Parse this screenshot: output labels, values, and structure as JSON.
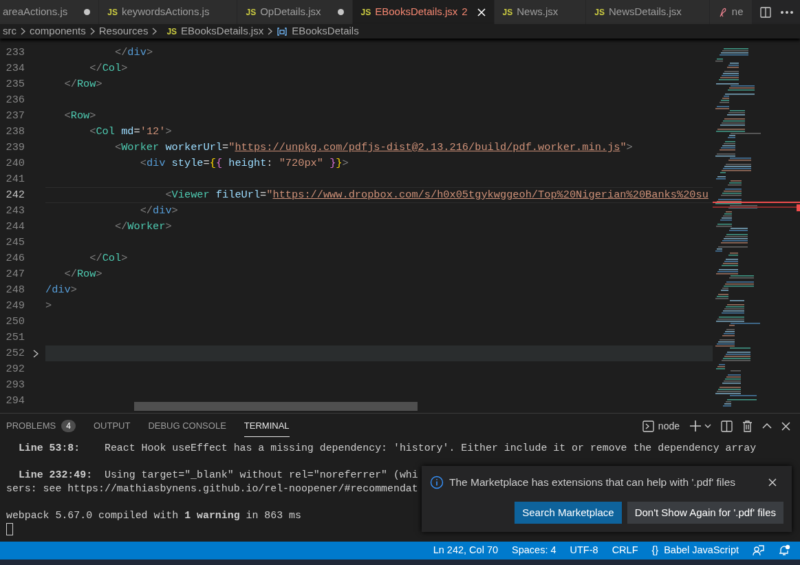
{
  "tabs": [
    {
      "label": "areaActions.js",
      "kind": "plain",
      "selected": false,
      "modified": true
    },
    {
      "label": "keywordsActions.js",
      "kind": "js",
      "icon_text": "JS",
      "selected": false,
      "modified": false
    },
    {
      "label": "OpDetails.jsx",
      "kind": "js",
      "icon_text": "JS",
      "selected": false,
      "modified": true
    },
    {
      "label": "EBooksDetails.jsx",
      "kind": "js",
      "icon_text": "JS",
      "selected": true,
      "modified": false,
      "problems": "2"
    },
    {
      "label": "News.jsx",
      "kind": "js",
      "icon_text": "JS",
      "selected": false,
      "modified": false
    },
    {
      "label": "NewsDetails.jsx",
      "kind": "js",
      "icon_text": "JS",
      "selected": false,
      "modified": false
    },
    {
      "label": "ne",
      "kind": "misc",
      "selected": false,
      "modified": false
    }
  ],
  "breadcrumb": [
    {
      "text": "src",
      "kind": "folder"
    },
    {
      "text": "components",
      "kind": "folder"
    },
    {
      "text": "Resources",
      "kind": "folder"
    },
    {
      "text": "EBooksDetails.jsx",
      "kind": "file",
      "icon_text": "JS"
    },
    {
      "text": "EBooksDetails",
      "kind": "symbol"
    }
  ],
  "lines": [
    {
      "number": "233",
      "current": false,
      "highlighted": false,
      "tokens": [
        {
          "kind": "p",
          "t": "           </"
        },
        {
          "kind": "html",
          "t": "div"
        },
        {
          "kind": "p",
          "t": ">"
        }
      ]
    },
    {
      "number": "234",
      "current": false,
      "highlighted": false,
      "tokens": [
        {
          "kind": "p",
          "t": "       </"
        },
        {
          "kind": "comp",
          "t": "Col"
        },
        {
          "kind": "p",
          "t": ">"
        }
      ]
    },
    {
      "number": "235",
      "current": false,
      "highlighted": false,
      "tokens": [
        {
          "kind": "p",
          "t": "   </"
        },
        {
          "kind": "comp",
          "t": "Row"
        },
        {
          "kind": "p",
          "t": ">"
        }
      ]
    },
    {
      "number": "236",
      "current": false,
      "highlighted": false
    },
    {
      "number": "237",
      "current": false,
      "highlighted": false,
      "tokens": [
        {
          "kind": "p",
          "t": "   <"
        },
        {
          "kind": "comp",
          "t": "Row"
        },
        {
          "kind": "p",
          "t": ">"
        }
      ]
    },
    {
      "number": "238",
      "current": false,
      "highlighted": false,
      "tokens": [
        {
          "kind": "p",
          "t": "       <"
        },
        {
          "kind": "comp",
          "t": "Col"
        },
        {
          "kind": "attr",
          "t": " md"
        },
        {
          "kind": "op",
          "t": "="
        },
        {
          "kind": "str",
          "t": "'12'"
        },
        {
          "kind": "p",
          "t": ">"
        }
      ]
    },
    {
      "number": "239",
      "current": false,
      "highlighted": false,
      "tokens": [
        {
          "kind": "p",
          "t": "           <"
        },
        {
          "kind": "comp",
          "t": "Worker"
        },
        {
          "kind": "attr",
          "t": " workerUrl"
        },
        {
          "kind": "op",
          "t": "="
        },
        {
          "kind": "str",
          "t": "\""
        },
        {
          "kind": "link",
          "t": "https://unpkg.com/pdfjs-dist@2.13.216/build/pdf.worker.min.js"
        },
        {
          "kind": "str",
          "t": "\""
        },
        {
          "kind": "p",
          "t": ">"
        }
      ]
    },
    {
      "number": "240",
      "current": false,
      "highlighted": false,
      "tokens": [
        {
          "kind": "p",
          "t": "               <"
        },
        {
          "kind": "html",
          "t": "div"
        },
        {
          "kind": "attr",
          "t": " style"
        },
        {
          "kind": "op",
          "t": "="
        },
        {
          "kind": "brace",
          "t": "{"
        },
        {
          "kind": "brace2",
          "t": "{"
        },
        {
          "kind": "attr",
          "t": " height"
        },
        {
          "kind": "op",
          "t": ": "
        },
        {
          "kind": "str",
          "t": "\"720px\""
        },
        {
          "kind": "brace2",
          "t": " }"
        },
        {
          "kind": "brace",
          "t": "}"
        },
        {
          "kind": "p",
          "t": ">"
        }
      ]
    },
    {
      "number": "241",
      "current": false,
      "highlighted": false
    },
    {
      "number": "242",
      "current": true,
      "highlighted": false,
      "tokens": [
        {
          "kind": "p",
          "t": "                   <"
        },
        {
          "kind": "comp",
          "t": "Viewer"
        },
        {
          "kind": "attr",
          "t": " fileUrl"
        },
        {
          "kind": "op",
          "t": "="
        },
        {
          "kind": "str",
          "t": "\""
        },
        {
          "kind": "link",
          "t": "https://www.dropbox.com/s/h0x05tgykwggeoh/Top%20Nigerian%20Banks%20su"
        }
      ]
    },
    {
      "number": "243",
      "current": false,
      "highlighted": false,
      "tokens": [
        {
          "kind": "p",
          "t": "               </"
        },
        {
          "kind": "html",
          "t": "div"
        },
        {
          "kind": "p",
          "t": ">"
        }
      ]
    },
    {
      "number": "244",
      "current": false,
      "highlighted": false,
      "tokens": [
        {
          "kind": "p",
          "t": "           </"
        },
        {
          "kind": "comp",
          "t": "Worker"
        },
        {
          "kind": "p",
          "t": ">"
        }
      ]
    },
    {
      "number": "245",
      "current": false,
      "highlighted": false
    },
    {
      "number": "246",
      "current": false,
      "highlighted": false,
      "tokens": [
        {
          "kind": "p",
          "t": "       </"
        },
        {
          "kind": "comp",
          "t": "Col"
        },
        {
          "kind": "p",
          "t": ">"
        }
      ]
    },
    {
      "number": "247",
      "current": false,
      "highlighted": false,
      "tokens": [
        {
          "kind": "p",
          "t": "   </"
        },
        {
          "kind": "comp",
          "t": "Row"
        },
        {
          "kind": "p",
          "t": ">"
        }
      ]
    },
    {
      "number": "248",
      "current": false,
      "highlighted": false,
      "tokens": [
        {
          "kind": "html",
          "t": "/div"
        },
        {
          "kind": "p",
          "t": ">"
        }
      ]
    },
    {
      "number": "249",
      "current": false,
      "highlighted": false,
      "tokens": [
        {
          "kind": "p",
          "t": ">"
        }
      ]
    },
    {
      "number": "250",
      "current": false,
      "highlighted": false
    },
    {
      "number": "251",
      "current": false,
      "highlighted": false
    },
    {
      "number": "252",
      "current": false,
      "highlighted": true
    },
    {
      "number": "292",
      "current": false,
      "highlighted": false
    },
    {
      "number": "293",
      "current": false,
      "highlighted": false
    },
    {
      "number": "294",
      "current": false,
      "highlighted": false
    }
  ],
  "panel": {
    "tabs": [
      {
        "label": "PROBLEMS",
        "badge": "4",
        "selected": false
      },
      {
        "label": "OUTPUT",
        "selected": false
      },
      {
        "label": "DEBUG CONSOLE",
        "selected": false
      },
      {
        "label": "TERMINAL",
        "selected": true
      }
    ],
    "terminal_name": "node",
    "terminal_lines": [
      {
        "text": "  **Line 53:8:**    React Hook useEffect has a missing dependency: 'history'. Either include it or remove the dependency array",
        "gap_before": false
      },
      {
        "text": "  **Line 232:49:**  Using target=\"_blank\" without rel=\"noreferrer\" (whi",
        "gap_before": true
      },
      {
        "text": "sers: see https://mathiasbynens.github.io/rel-noopener/#recommendat",
        "gap_before": false
      },
      {
        "text": "webpack 5.67.0 compiled with **1 warning** in 863 ms",
        "gap_before": true
      }
    ]
  },
  "notification": {
    "message": "The Marketplace has extensions that can help with '.pdf' files",
    "buttons": [
      {
        "label": "Search Marketplace",
        "primary": true
      },
      {
        "label": "Don't Show Again for '.pdf' files",
        "primary": false
      }
    ]
  },
  "status_bar": [
    {
      "text": "Ln 242, Col 70"
    },
    {
      "text": "Spaces: 4"
    },
    {
      "text": "UTF-8"
    },
    {
      "text": "CRLF"
    },
    {
      "icon_text": "{}",
      "text": "Babel JavaScript"
    }
  ]
}
